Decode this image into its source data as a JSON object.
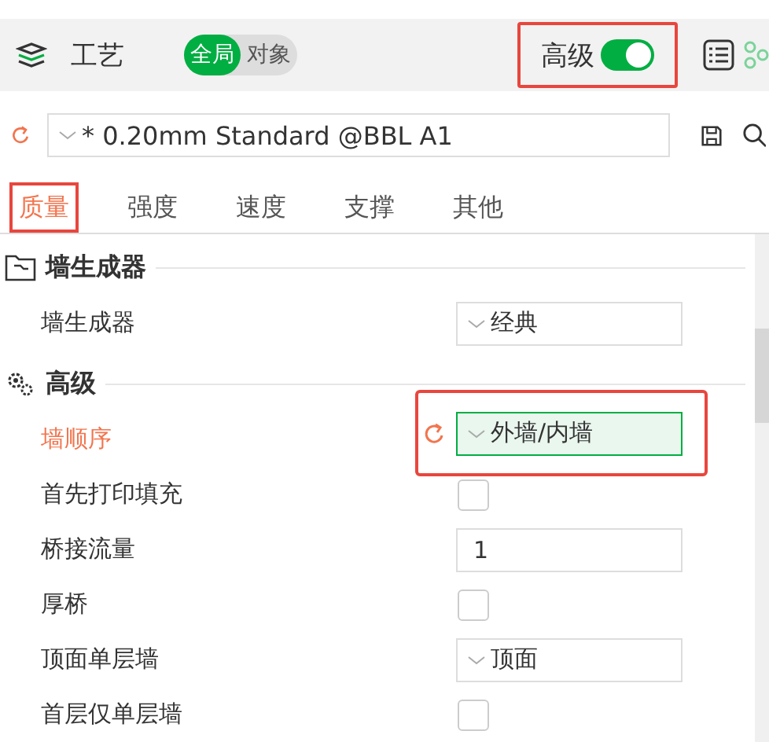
{
  "header": {
    "title": "工艺",
    "scope_tabs": [
      {
        "label": "全局",
        "selected": true
      },
      {
        "label": "对象",
        "selected": false
      }
    ],
    "advanced": {
      "label": "高级",
      "on": true,
      "highlighted": true
    }
  },
  "preset": {
    "value": "* 0.20mm Standard @BBL A1",
    "modified": true
  },
  "tabs": [
    {
      "label": "质量",
      "selected": true,
      "highlighted": true
    },
    {
      "label": "强度",
      "selected": false,
      "highlighted": false
    },
    {
      "label": "速度",
      "selected": false,
      "highlighted": false
    },
    {
      "label": "支撑",
      "selected": false,
      "highlighted": false
    },
    {
      "label": "其他",
      "selected": false,
      "highlighted": false
    }
  ],
  "sections": [
    {
      "title": "墙生成器",
      "kind": "wall",
      "rows": [
        {
          "label": "墙生成器",
          "kind": "select",
          "value": "经典",
          "modified": false,
          "highlighted": false
        }
      ]
    },
    {
      "title": "高级",
      "kind": "advanced",
      "rows": [
        {
          "label": "墙顺序",
          "kind": "select",
          "value": "外墙/内墙",
          "modified": true,
          "highlighted": true
        },
        {
          "label": "首先打印填充",
          "kind": "checkbox",
          "checked": false,
          "modified": false,
          "highlighted": false
        },
        {
          "label": "桥接流量",
          "kind": "number",
          "value": "1",
          "modified": false,
          "highlighted": false
        },
        {
          "label": "厚桥",
          "kind": "checkbox",
          "checked": false,
          "modified": false,
          "highlighted": false
        },
        {
          "label": "顶面单层墙",
          "kind": "select",
          "value": "顶面",
          "modified": false,
          "highlighted": false
        },
        {
          "label": "首层仅单层墙",
          "kind": "checkbox",
          "checked": false,
          "modified": false,
          "highlighted": false
        }
      ]
    }
  ]
}
